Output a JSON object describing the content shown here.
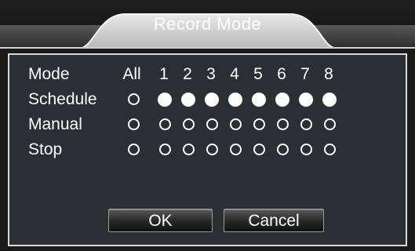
{
  "dialog": {
    "title": "Record Mode"
  },
  "table": {
    "mode_label": "Mode",
    "columns": [
      "All",
      "1",
      "2",
      "3",
      "4",
      "5",
      "6",
      "7",
      "8"
    ],
    "rows": [
      {
        "label": "Schedule",
        "selected": [
          false,
          true,
          true,
          true,
          true,
          true,
          true,
          true,
          true
        ]
      },
      {
        "label": "Manual",
        "selected": [
          false,
          false,
          false,
          false,
          false,
          false,
          false,
          false,
          false
        ]
      },
      {
        "label": "Stop",
        "selected": [
          false,
          false,
          false,
          false,
          false,
          false,
          false,
          false,
          false
        ]
      }
    ]
  },
  "buttons": {
    "ok_label": "OK",
    "cancel_label": "Cancel"
  },
  "colors": {
    "panel": "#2b2f33",
    "border": "#d8d8d8",
    "text": "#ffffff"
  }
}
